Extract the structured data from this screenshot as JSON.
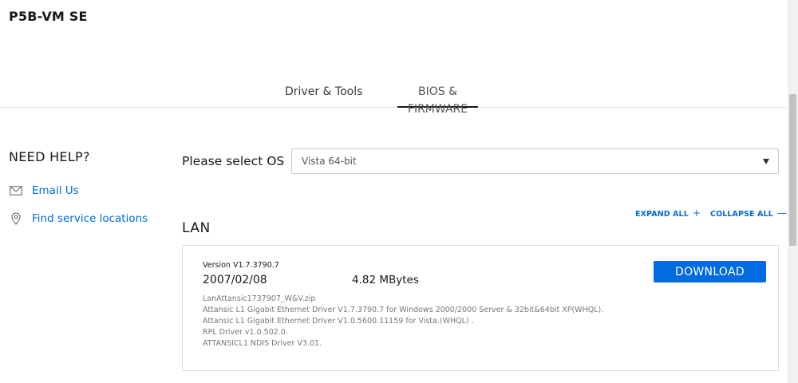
{
  "product": {
    "title": "P5B-VM SE"
  },
  "tabs": [
    {
      "label": "Driver & Tools",
      "active": false
    },
    {
      "label": "BIOS & FIRMWARE",
      "active": true
    }
  ],
  "help": {
    "title": "NEED HELP?",
    "links": [
      {
        "label": "Email Us",
        "icon": "mail-icon"
      },
      {
        "label": "Find service locations",
        "icon": "location-pin-icon"
      }
    ]
  },
  "os_select": {
    "label": "Please select OS",
    "value": "Vista 64-bit"
  },
  "controls": {
    "expand_all": "EXPAND ALL",
    "collapse_all": "COLLAPSE ALL"
  },
  "section": {
    "title": "LAN",
    "items": [
      {
        "version": "Version V1.7.3790.7",
        "date": "2007/02/08",
        "size": "4.82 MBytes",
        "download_label": "DOWNLOAD",
        "description": [
          "LanAttansic1737907_W&V.zip",
          "Attansic L1 Gigabit Ethernet Driver V1.7.3790.7 for Windows 2000/2000 Server & 32bit&64bit XP(WHQL).",
          "Attansic L1 Gigabit Ethernet Driver V1.0.5600.11159 for Vista.(WHQL) .",
          "RPL Driver v1.0.502.0.",
          "ATTANSICL1 NDIS Driver V3.01."
        ]
      }
    ]
  },
  "colors": {
    "accent": "#006ce0",
    "text": "#181818",
    "muted": "#777777",
    "border": "#dcdcdc"
  }
}
